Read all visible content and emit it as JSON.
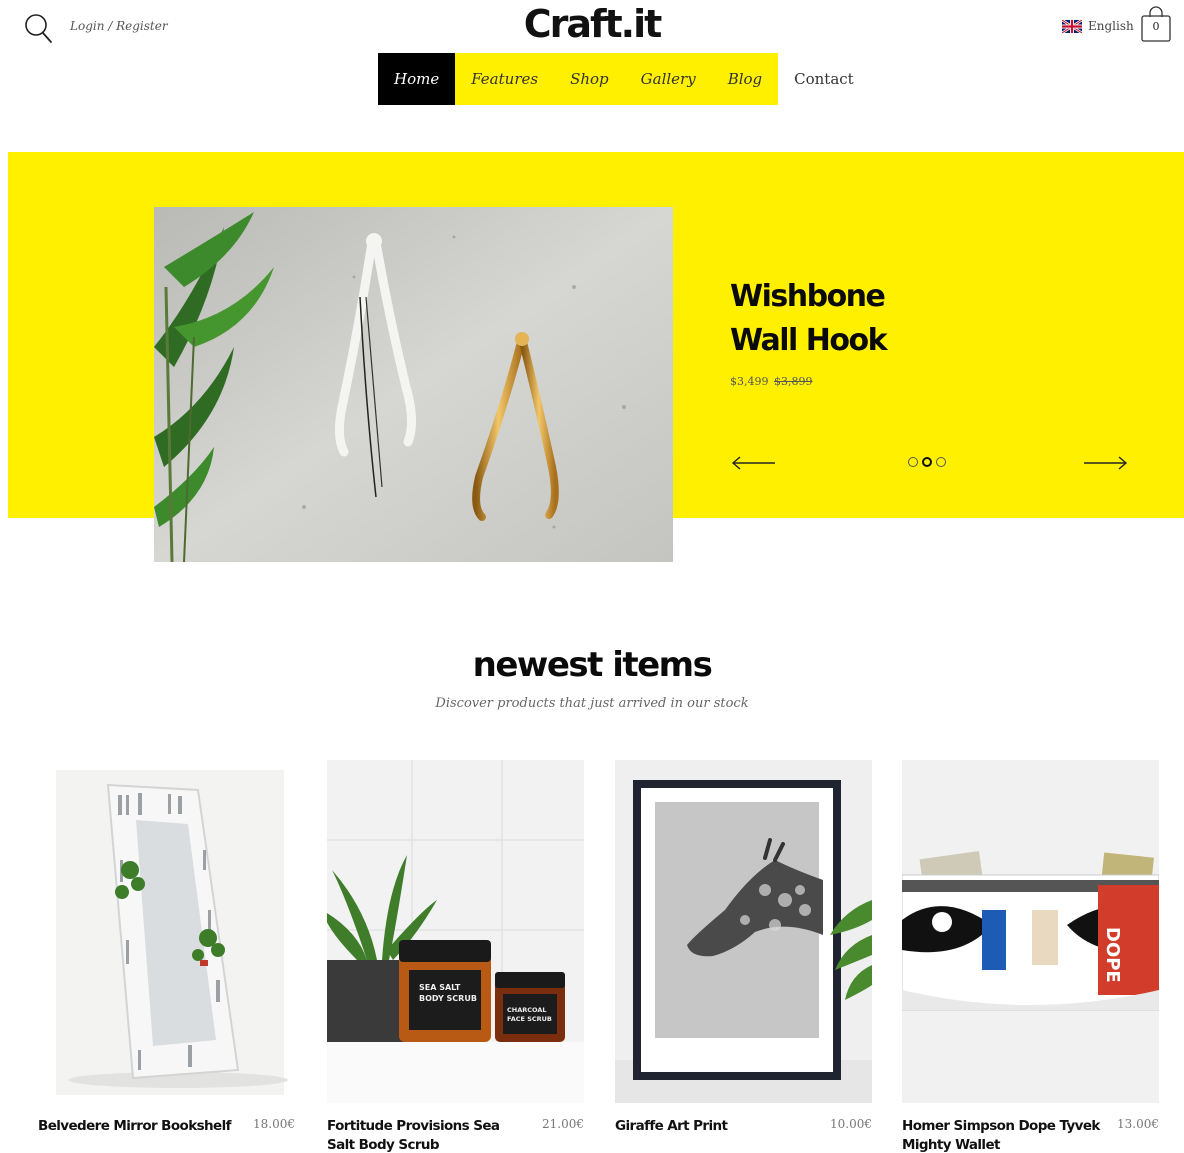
{
  "header": {
    "login_label": "Login / Register",
    "logo": "Craft.it",
    "language": "English",
    "cart_count": "0"
  },
  "nav": {
    "items": [
      {
        "label": "Home"
      },
      {
        "label": "Features"
      },
      {
        "label": "Shop"
      },
      {
        "label": "Gallery"
      },
      {
        "label": "Blog"
      },
      {
        "label": "Contact"
      }
    ]
  },
  "hero": {
    "title_line1": "Wishbone",
    "title_line2": "Wall Hook",
    "price": "$3,499",
    "old_price": "$3,899",
    "slide_count": 3,
    "active_slide": 2
  },
  "newest": {
    "title": "newest items",
    "subtitle": "Discover products that just arrived in our stock",
    "products": [
      {
        "name": "Belvedere Mirror Bookshelf",
        "price": "18.00€"
      },
      {
        "name": "Fortitude Provisions Sea Salt Body Scrub",
        "price": "21.00€"
      },
      {
        "name": "Giraffe Art Print",
        "price": "10.00€"
      },
      {
        "name": "Homer Simpson Dope Tyvek Mighty Wallet",
        "price": "13.00€"
      }
    ]
  },
  "colors": {
    "accent_yellow": "#fff000",
    "nav_active": "#000000"
  }
}
